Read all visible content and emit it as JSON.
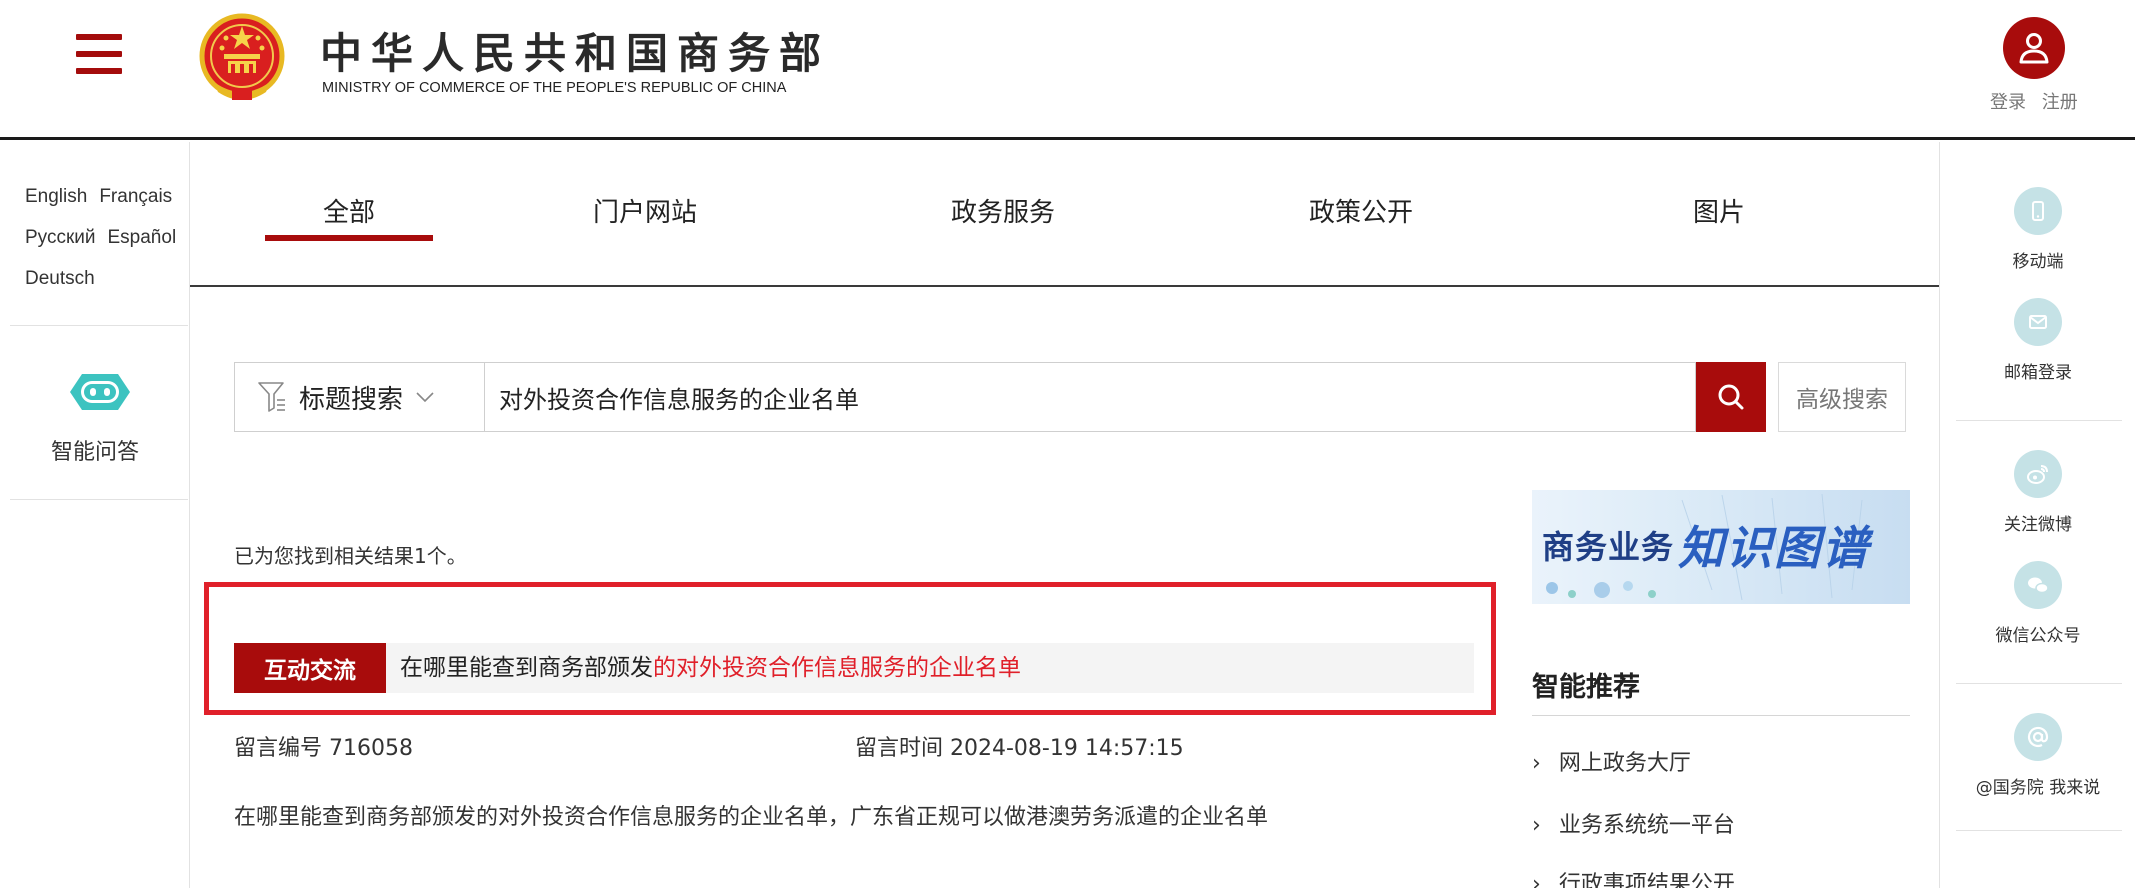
{
  "header": {
    "brand_cn": "中华人民共和国商务部",
    "brand_en": "MINISTRY OF COMMERCE OF THE PEOPLE'S REPUBLIC OF CHINA",
    "login": "登录",
    "register": "注册",
    "accent_color": "#a80c0c"
  },
  "left_sidebar": {
    "languages": [
      "English",
      "Français",
      "Русский",
      "Español",
      "Deutsch"
    ],
    "ai_qa_label": "智能问答"
  },
  "right_sidebar": {
    "items": [
      {
        "label": "移动端",
        "icon": "mobile-icon"
      },
      {
        "label": "邮箱登录",
        "icon": "mail-icon"
      },
      {
        "label": "关注微博",
        "icon": "weibo-icon"
      },
      {
        "label": "微信公众号",
        "icon": "wechat-icon"
      },
      {
        "label": "@国务院 我来说",
        "icon": "at-icon"
      }
    ]
  },
  "tabs": [
    {
      "label": "全部",
      "active": true
    },
    {
      "label": "门户网站",
      "active": false
    },
    {
      "label": "政务服务",
      "active": false
    },
    {
      "label": "政策公开",
      "active": false
    },
    {
      "label": "图片",
      "active": false
    }
  ],
  "search": {
    "type_label": "标题搜索",
    "query": "对外投资合作信息服务的企业名单",
    "advanced_label": "高级搜索"
  },
  "results": {
    "count_text": "已为您找到相关结果1个。",
    "items": [
      {
        "tag": "互动交流",
        "title_prefix": "在哪里能查到商务部颁发",
        "title_highlight": "的对外投资合作信息服务的企业名单",
        "message_no": "留言编号 716058",
        "message_time": "留言时间 2024-08-19 14:57:15",
        "description": "在哪里能查到商务部颁发的对外投资合作信息服务的企业名单，广东省正规可以做港澳劳务派遣的企业名单"
      }
    ]
  },
  "banner": {
    "text_a": "商务业务",
    "text_b": "知识图谱"
  },
  "recommend": {
    "title": "智能推荐",
    "items": [
      "网上政务大厅",
      "业务系统统一平台",
      "行政事项结果公开"
    ]
  }
}
